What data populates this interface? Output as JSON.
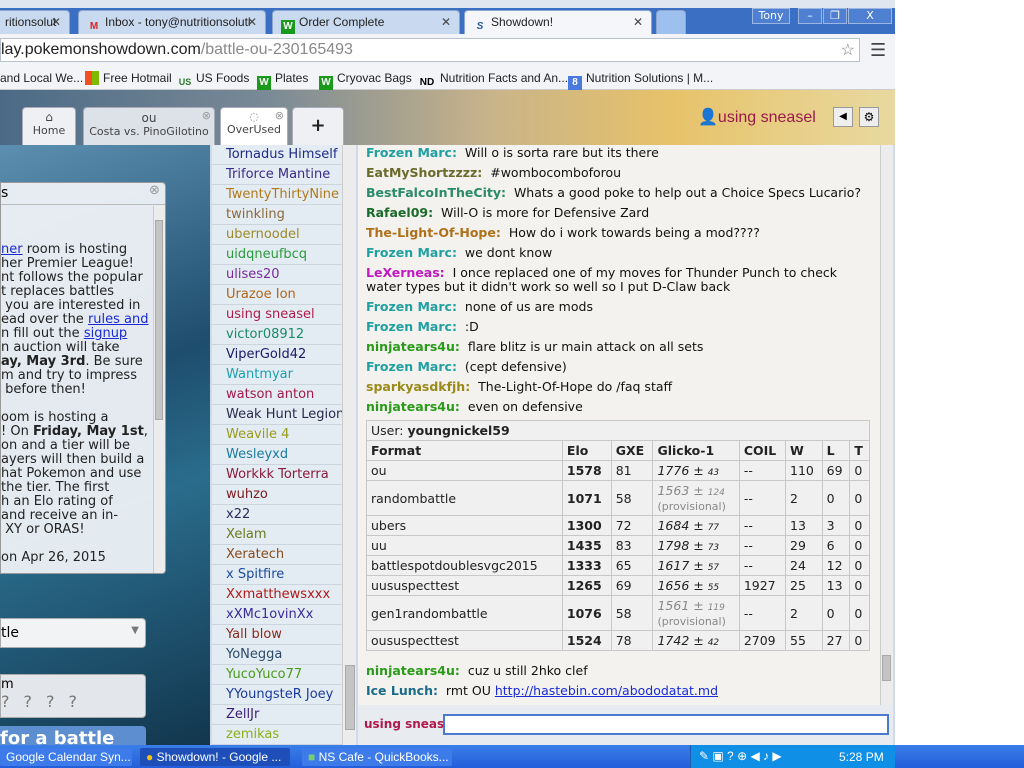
{
  "browser": {
    "tabs": [
      {
        "label": "ritionsolut",
        "icon": "favicon-generic"
      },
      {
        "label": "Inbox - tony@nutritionsoluti",
        "icon": "gmail-icon"
      },
      {
        "label": "Order Complete",
        "icon": "w-icon"
      },
      {
        "label": "Showdown!",
        "icon": "showdown-icon"
      }
    ],
    "profile": "Tony",
    "url_host": "lay.pokemonshowdown.com",
    "url_path": "/battle-ou-230165493",
    "bookmarks": [
      "and Local We...",
      "Free Hotmail",
      "US Foods",
      "Plates",
      "Cryovac Bags",
      "Nutrition Facts and An...",
      "Nutrition Solutions | M..."
    ],
    "bookmark_icons": [
      "",
      "ms",
      "US",
      "W",
      "W",
      "ND",
      "8"
    ]
  },
  "showdown": {
    "tabs": {
      "home": "Home",
      "battle_format": "ou",
      "battle_players": "Costa vs. PinoGilotino",
      "room": "OverUsed",
      "add": "+"
    },
    "username": "using sneasel",
    "news": {
      "title": "s",
      "footer": "on Apr 26, 2015"
    },
    "format_select": "tle",
    "team_label": "m",
    "battle_button": "for a battle"
  },
  "userlist": [
    {
      "name": "Tornadus Himself",
      "color": "#1f2a8a"
    },
    {
      "name": "Triforce Mantine",
      "color": "#3a2a8a"
    },
    {
      "name": "TwentyThirtyNine",
      "color": "#b07a1a"
    },
    {
      "name": "twinkling",
      "color": "#8a6a3a"
    },
    {
      "name": "ubernoodel",
      "color": "#9a8a2a"
    },
    {
      "name": "uidqneufbcq",
      "color": "#2a9a3a"
    },
    {
      "name": "ulises20",
      "color": "#7a2a9a"
    },
    {
      "name": "Urazoe Ion",
      "color": "#b0661a"
    },
    {
      "name": "using sneasel",
      "color": "#b01a4a"
    },
    {
      "name": "victor08912",
      "color": "#1a8a6a"
    },
    {
      "name": "ViperGold42",
      "color": "#1a1a6a"
    },
    {
      "name": "Wantmyar",
      "color": "#1aa0b0"
    },
    {
      "name": "watson anton",
      "color": "#a01a4a"
    },
    {
      "name": "Weak Hunt Legion",
      "color": "#2a2a4a"
    },
    {
      "name": "Weavile 4",
      "color": "#9a9a1a"
    },
    {
      "name": "Wesleyxd",
      "color": "#1a7aa0"
    },
    {
      "name": "Workkk Torterra",
      "color": "#8a1a3a"
    },
    {
      "name": "wuhzo",
      "color": "#7a1a1a"
    },
    {
      "name": "x22",
      "color": "#2a2a5a"
    },
    {
      "name": "Xelam",
      "color": "#6a7a1a"
    },
    {
      "name": "Xeratech",
      "color": "#8a4a1a"
    },
    {
      "name": "x Spitfire",
      "color": "#1a4aa0"
    },
    {
      "name": "Xxmatthewsxxx",
      "color": "#b01a1a"
    },
    {
      "name": "xXMc1ovinXx",
      "color": "#3a2a9a"
    },
    {
      "name": "Yall blow",
      "color": "#8a2a1a"
    },
    {
      "name": "YoNegga",
      "color": "#2a4a6a"
    },
    {
      "name": "YucoYuco77",
      "color": "#4a9a1a"
    },
    {
      "name": "YYoungsteR Joey",
      "color": "#1a3aa0"
    },
    {
      "name": "ZellJr",
      "color": "#3a1a7a"
    },
    {
      "name": "zemikas",
      "color": "#8ab01a"
    }
  ],
  "chat": [
    {
      "user": "Frozen Marc:",
      "color": "#20a0a0",
      "text": "Will o is sorta rare but its there"
    },
    {
      "user": "EatMyShortzzzz:",
      "color": "#6a6a2a",
      "text": "#wombocomboforou"
    },
    {
      "user": "BestFalcoInTheCity:",
      "color": "#2a8a6a",
      "text": "Whats a good poke to help out a Choice Specs Lucario?"
    },
    {
      "user": "Rafael09:",
      "color": "#1a6a2a",
      "text": "Will-O is more for Defensive Zard"
    },
    {
      "user": "The-Light-Of-Hope:",
      "color": "#b0701a",
      "text": "How do i work towards being a mod????"
    },
    {
      "user": "Frozen Marc:",
      "color": "#20a0a0",
      "text": "we dont know"
    },
    {
      "user": "LeXerneas:",
      "color": "#c01ac0",
      "text": "I once replaced one of my moves for Thunder Punch to check\nwater types but it didn't work so well so I put D-Claw back"
    },
    {
      "user": "Frozen Marc:",
      "color": "#20a0a0",
      "text": "none of us are mods"
    },
    {
      "user": "Frozen Marc:",
      "color": "#20a0a0",
      "text": ":D"
    },
    {
      "user": "ninjatears4u:",
      "color": "#2a9a1a",
      "text": "flare blitz is ur main attack on all sets"
    },
    {
      "user": "Frozen Marc:",
      "color": "#20a0a0",
      "text": "(cept defensive)"
    },
    {
      "user": "sparkyasdkfjh:",
      "color": "#9a8a1a",
      "text": "The-Light-Of-Hope do /faq staff"
    },
    {
      "user": "ninjatears4u:",
      "color": "#2a9a1a",
      "text": "even on defensive"
    }
  ],
  "chat_after": [
    {
      "user": "ninjatears4u:",
      "color": "#2a9a1a",
      "text": "cuz u still 2hko clef"
    },
    {
      "user": "Ice Lunch:",
      "color": "#1a6a8a",
      "text": "rmt OU ",
      "link": "http://hastebin.com/abododatat.md"
    }
  ],
  "ranking": {
    "user_label": "User:",
    "user": "youngnickel59",
    "headers": [
      "Format",
      "Elo",
      "GXE",
      "Glicko-1",
      "COIL",
      "W",
      "L",
      "T"
    ],
    "rows": [
      {
        "format": "ou",
        "elo": "1578",
        "gxe": "81",
        "glicko": "1776",
        "dev": "43",
        "prov": "",
        "coil": "--",
        "w": "110",
        "l": "69",
        "t": "0"
      },
      {
        "format": "randombattle",
        "elo": "1071",
        "gxe": "58",
        "glicko": "1563",
        "dev": "124",
        "prov": "(provisional)",
        "coil": "--",
        "w": "2",
        "l": "0",
        "t": "0"
      },
      {
        "format": "ubers",
        "elo": "1300",
        "gxe": "72",
        "glicko": "1684",
        "dev": "77",
        "prov": "",
        "coil": "--",
        "w": "13",
        "l": "3",
        "t": "0"
      },
      {
        "format": "uu",
        "elo": "1435",
        "gxe": "83",
        "glicko": "1798",
        "dev": "73",
        "prov": "",
        "coil": "--",
        "w": "29",
        "l": "6",
        "t": "0"
      },
      {
        "format": "battlespotdoublesvgc2015",
        "elo": "1333",
        "gxe": "65",
        "glicko": "1617",
        "dev": "57",
        "prov": "",
        "coil": "--",
        "w": "24",
        "l": "12",
        "t": "0"
      },
      {
        "format": "uususpecttest",
        "elo": "1265",
        "gxe": "69",
        "glicko": "1656",
        "dev": "55",
        "prov": "",
        "coil": "1927",
        "w": "25",
        "l": "13",
        "t": "0"
      },
      {
        "format": "gen1randombattle",
        "elo": "1076",
        "gxe": "58",
        "glicko": "1561",
        "dev": "119",
        "prov": "(provisional)",
        "coil": "--",
        "w": "2",
        "l": "0",
        "t": "0"
      },
      {
        "format": "oususpecttest",
        "elo": "1524",
        "gxe": "78",
        "glicko": "1742",
        "dev": "42",
        "prov": "",
        "coil": "2709",
        "w": "55",
        "l": "27",
        "t": "0"
      }
    ]
  },
  "input": {
    "name_label": "using sneas",
    "value": ""
  },
  "taskbar": {
    "items": [
      "Google Calendar Syn...",
      "Showdown! - Google ...",
      "NS Cafe - QuickBooks..."
    ],
    "clock": "5:28 PM"
  }
}
